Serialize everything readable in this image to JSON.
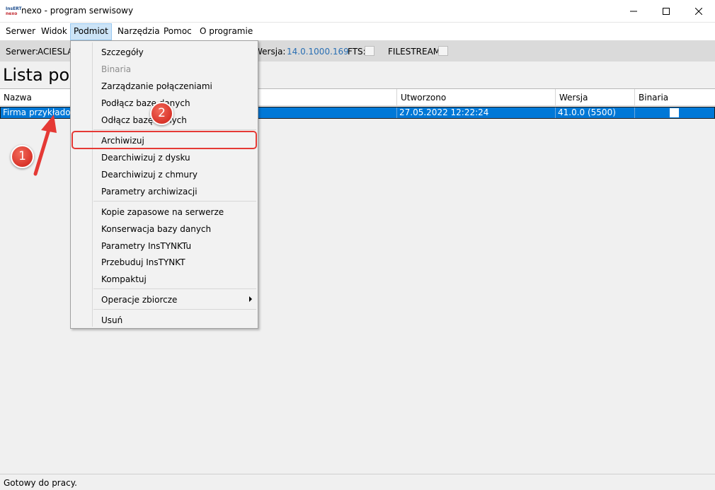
{
  "window": {
    "logo_line1": "InsERT",
    "logo_line2": "nexo",
    "title": "nexo - program serwisowy"
  },
  "menubar": {
    "items": [
      "Serwer",
      "Widok",
      "Podmiot",
      "Narzędzia",
      "Pomoc",
      "O programie"
    ],
    "active": "Podmiot"
  },
  "infobar": {
    "server_label": "Serwer:",
    "server_value": "ACIESLAV",
    "version_label": "Wersja:",
    "version_value": "14.0.1000.169",
    "fts_label": "FTS:",
    "filestream_label": "FILESTREAM:"
  },
  "heading": "Lista pod",
  "table": {
    "columns": [
      "Nazwa",
      "Utworzono",
      "Wersja",
      "Binaria"
    ],
    "rows": [
      {
        "nazwa": "Firma przykładowa",
        "utworzono": "27.05.2022 12:22:24",
        "wersja": "41.0.0 (5500)",
        "binaria": false
      }
    ]
  },
  "status": "Gotowy do pracy.",
  "dropdown": {
    "items": [
      {
        "label": "Szczegóły",
        "disabled": false
      },
      {
        "label": "Binaria",
        "disabled": true
      },
      {
        "label": "Zarządzanie połączeniami",
        "disabled": false
      },
      {
        "label": "Podłącz bazę danych",
        "disabled": false
      },
      {
        "label": "Odłącz bazę danych",
        "disabled": false
      },
      {
        "label": "Archiwizuj",
        "disabled": false
      },
      {
        "label": "Dearchiwizuj z dysku",
        "disabled": false
      },
      {
        "label": "Dearchiwizuj z chmury",
        "disabled": false
      },
      {
        "label": "Parametry archiwizacji",
        "disabled": false
      },
      {
        "label": "Kopie zapasowe na serwerze",
        "disabled": false
      },
      {
        "label": "Konserwacja bazy danych",
        "disabled": false
      },
      {
        "label": "Parametry InsTYNKTu",
        "disabled": false
      },
      {
        "label": "Przebuduj InsTYNKT",
        "disabled": false
      },
      {
        "label": "Kompaktuj",
        "disabled": false
      },
      {
        "label": "Operacje zbiorcze",
        "disabled": false,
        "submenu": true
      },
      {
        "label": "Usuń",
        "disabled": false
      }
    ]
  },
  "annotations": {
    "badge1": "1",
    "badge2": "2",
    "color": "#e53935"
  },
  "colors": {
    "selection": "#0078d7",
    "menu_active": "#cce4f7",
    "version_text": "#2a6fb3"
  }
}
